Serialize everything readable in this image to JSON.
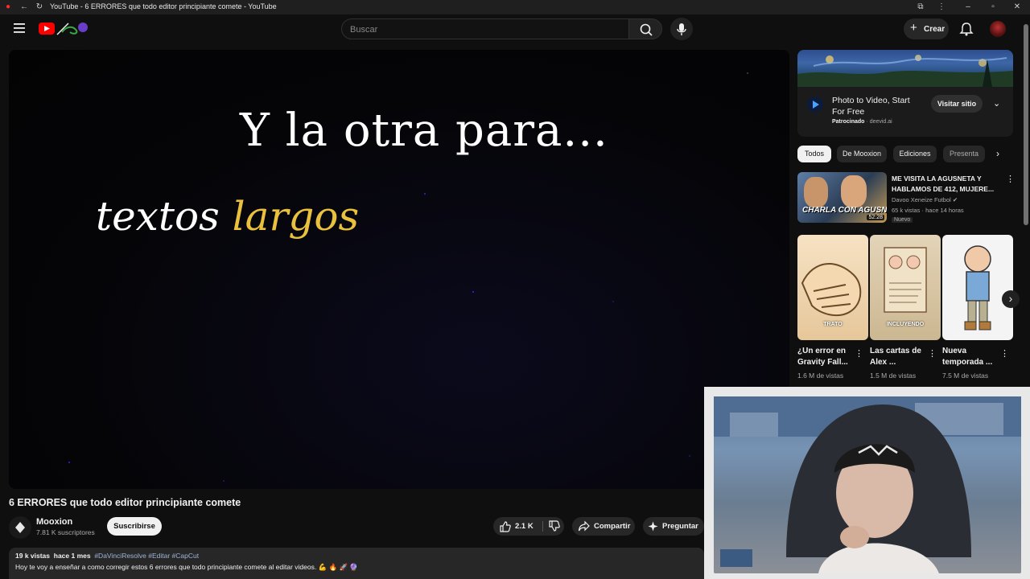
{
  "browser": {
    "tab_title": "YouTube - 6 ERRORES que todo editor principiante comete - YouTube"
  },
  "masthead": {
    "search_placeholder": "Buscar",
    "create_label": "Crear"
  },
  "video": {
    "overlay_line1": "Y la otra para...",
    "overlay_word_white": "textos",
    "overlay_word_yellow": "largos",
    "title": "6 ERRORES que todo editor principiante comete",
    "channel_name": "Mooxion",
    "subscribers": "7.81 K suscriptores",
    "subscribe_label": "Suscribirse",
    "likes": "2.1 K",
    "share_label": "Compartir",
    "ask_label": "Preguntar",
    "views": "19 k vistas",
    "age": "hace 1 mes",
    "hashtags": "#DaVinciResolve #Editar #CapCut",
    "description": "Hoy te voy a enseñar a como corregir estos 6 errores que todo principiante comete al editar videos. 💪 🔥 🚀 🔮"
  },
  "ad": {
    "title": "Photo to Video, Start For Free",
    "sponsored": "Patrocinado",
    "domain": "deevid.ai",
    "cta": "Visitar sitio"
  },
  "chips": [
    "Todos",
    "De Mooxion",
    "Ediciones",
    "Presenta"
  ],
  "recommended": {
    "title": "ME VISITA LA AGUSNETA Y HABLAMOS DE 412, MUJERE...",
    "channel": "Davoo Xeneize Futbol",
    "stats": "65 k vistas · hace 14 horas",
    "badge": "Nuevo",
    "duration": "52:28",
    "thumb_text": "CHARLA CON AGUSN"
  },
  "shorts": [
    {
      "title": "¿Un error en Gravity Fall...",
      "views": "1.6 M de vistas",
      "caption": "TRATO"
    },
    {
      "title": "Las cartas de Alex ...",
      "views": "1.5 M de vistas",
      "caption": "INCLUYENDO"
    },
    {
      "title": "Nueva temporada ...",
      "views": "7.5 M de vistas",
      "caption": ""
    }
  ],
  "colors": {
    "background": "#0f0f0f",
    "accent_red": "#ff0000",
    "overlay_yellow": "#e9c13c"
  }
}
